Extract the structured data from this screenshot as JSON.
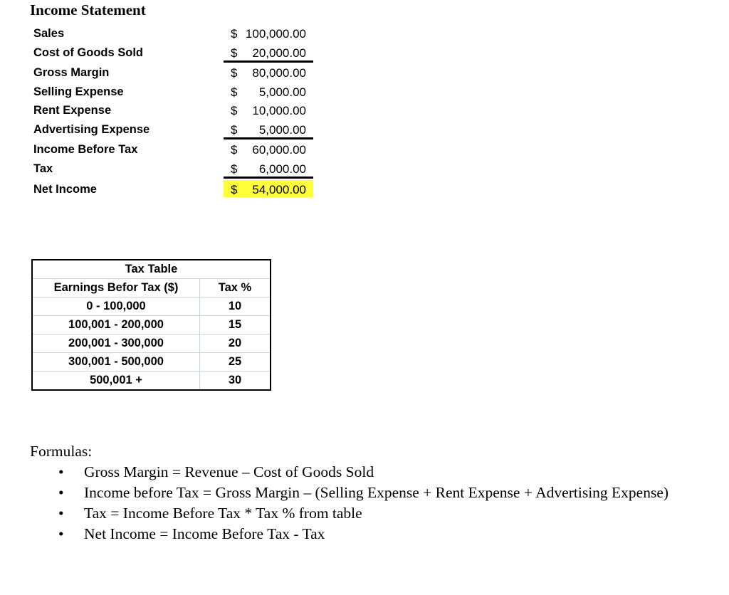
{
  "income_statement": {
    "title": "Income Statement",
    "currency": "$",
    "rows": [
      {
        "label": "Sales",
        "amount": "100,000.00"
      },
      {
        "label": "Cost of Goods Sold",
        "amount": "20,000.00"
      },
      {
        "label": "Gross Margin",
        "amount": "80,000.00"
      },
      {
        "label": "Selling Expense",
        "amount": "5,000.00"
      },
      {
        "label": "Rent Expense",
        "amount": "10,000.00"
      },
      {
        "label": "Advertising Expense",
        "amount": "5,000.00"
      },
      {
        "label": "Income Before Tax",
        "amount": "60,000.00"
      },
      {
        "label": "Tax",
        "amount": "6,000.00"
      },
      {
        "label": "Net Income",
        "amount": "54,000.00"
      }
    ],
    "highlight_color": "#ffff3a"
  },
  "tax_table": {
    "title": "Tax Table",
    "headers": [
      "Earnings Befor Tax ($)",
      "Tax %"
    ],
    "rows": [
      [
        "0 - 100,000",
        "10"
      ],
      [
        "100,001 - 200,000",
        "15"
      ],
      [
        "200,001 - 300,000",
        "20"
      ],
      [
        "300,001 - 500,000",
        "25"
      ],
      [
        "500,001 +",
        "30"
      ]
    ]
  },
  "formulas": {
    "heading": "Formulas:",
    "bullet": "•",
    "items": [
      "Gross Margin = Revenue – Cost of Goods Sold",
      "Income before Tax = Gross Margin – (Selling Expense + Rent Expense + Advertising Expense)",
      "Tax = Income Before Tax * Tax % from table",
      "Net Income = Income Before Tax - Tax"
    ]
  }
}
